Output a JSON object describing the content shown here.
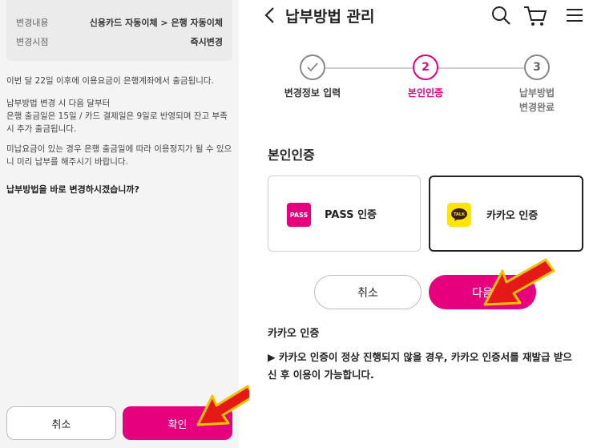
{
  "left_panel": {
    "summary": [
      {
        "key": "변경내용",
        "value": "신용카드 자동이체 > 은행 자동이체"
      },
      {
        "key": "변경시점",
        "value": "즉시변경"
      }
    ],
    "notice_1": "이번 달 22일 이후에 이용요금이 은행계좌에서 출금됩니다.",
    "notice_2": "납부방법 변경 시 다음 달부터\n은행 출금일은 15일 / 카드 결제일은 9일로 반영되며 잔고 부족 시 추가 출금됩니다.",
    "notice_3": "미납요금이 있는 경우 은행 출금일에 따라 이용정지가 될 수 있으니 미리 납부를 해주시기 바랍니다.",
    "question": "납부방법을 바로 변경하시겠습니까?",
    "cancel_label": "취소",
    "confirm_label": "확인"
  },
  "right_panel": {
    "title": "납부방법 관리",
    "icons": [
      "back-arrow-icon",
      "search-icon",
      "cart-icon",
      "menu-icon"
    ],
    "steps": [
      {
        "number": "1",
        "label": "변경정보 입력",
        "state": "done"
      },
      {
        "number": "2",
        "label": "본인인증",
        "state": "active"
      },
      {
        "number": "3",
        "label": "납부방법\n변경완료",
        "state": "pending"
      }
    ],
    "section_title": "본인인증",
    "auth_options": [
      {
        "logo": "PASS",
        "label": "PASS 인증",
        "selected": false
      },
      {
        "logo": "TALK",
        "label": "카카오 인증",
        "selected": true
      }
    ],
    "cancel_label": "취소",
    "next_label": "다음",
    "info_title": "카카오 인증",
    "info_text": "▶ 카카오 인증이 정상 진행되지 않을 경우, 카카오 인증서를 재발급 받으신 후 이용이 가능합니다."
  },
  "colors": {
    "accent": "#e6007e",
    "kakao": "#fee500",
    "arrow": "#e61919"
  }
}
